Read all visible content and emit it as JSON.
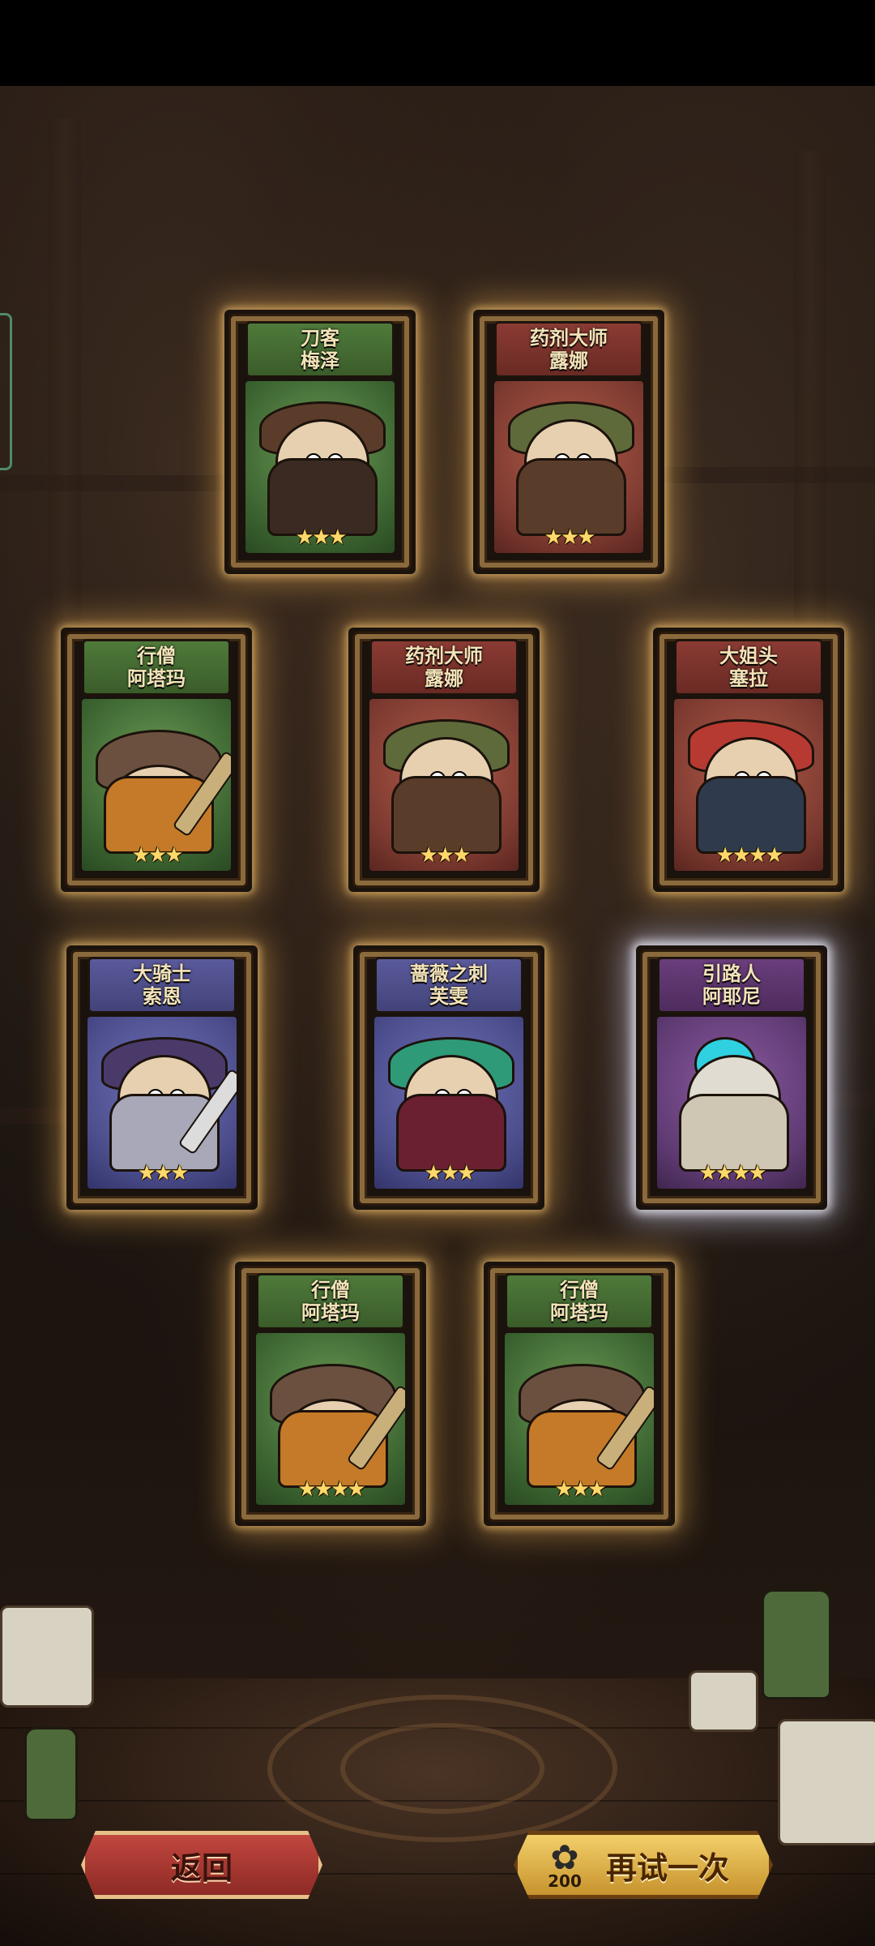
{
  "cards": [
    {
      "title": "刀客",
      "name": "梅泽",
      "stars": "★★★",
      "color": "green",
      "highlight": false
    },
    {
      "title": "药剂大师",
      "name": "露娜",
      "stars": "★★★",
      "color": "red",
      "highlight": false
    },
    {
      "title": "行僧",
      "name": "阿塔玛",
      "stars": "★★★",
      "color": "green",
      "highlight": false
    },
    {
      "title": "药剂大师",
      "name": "露娜",
      "stars": "★★★",
      "color": "red",
      "highlight": false
    },
    {
      "title": "大姐头",
      "name": "塞拉",
      "stars": "★★★★",
      "color": "red",
      "highlight": false
    },
    {
      "title": "大骑士",
      "name": "索恩",
      "stars": "★★★",
      "color": "blue",
      "highlight": false
    },
    {
      "title": "蔷薇之刺",
      "name": "芙雯",
      "stars": "★★★",
      "color": "blue",
      "highlight": false
    },
    {
      "title": "引路人",
      "name": "阿耶尼",
      "stars": "★★★★",
      "color": "purple",
      "highlight": true
    },
    {
      "title": "行僧",
      "name": "阿塔玛",
      "stars": "★★★★",
      "color": "green",
      "highlight": false
    },
    {
      "title": "行僧",
      "name": "阿塔玛",
      "stars": "★★★",
      "color": "green",
      "highlight": false
    }
  ],
  "buttons": {
    "back_label": "返回",
    "retry_label": "再试一次",
    "retry_cost": "200",
    "retry_cost_icon": "clover-icon"
  },
  "colors": {
    "green": "#4f7a3a",
    "red": "#8a3b33",
    "blue": "#5a5a9c",
    "purple": "#6a3e7c",
    "gold": "#f3cf6a"
  }
}
